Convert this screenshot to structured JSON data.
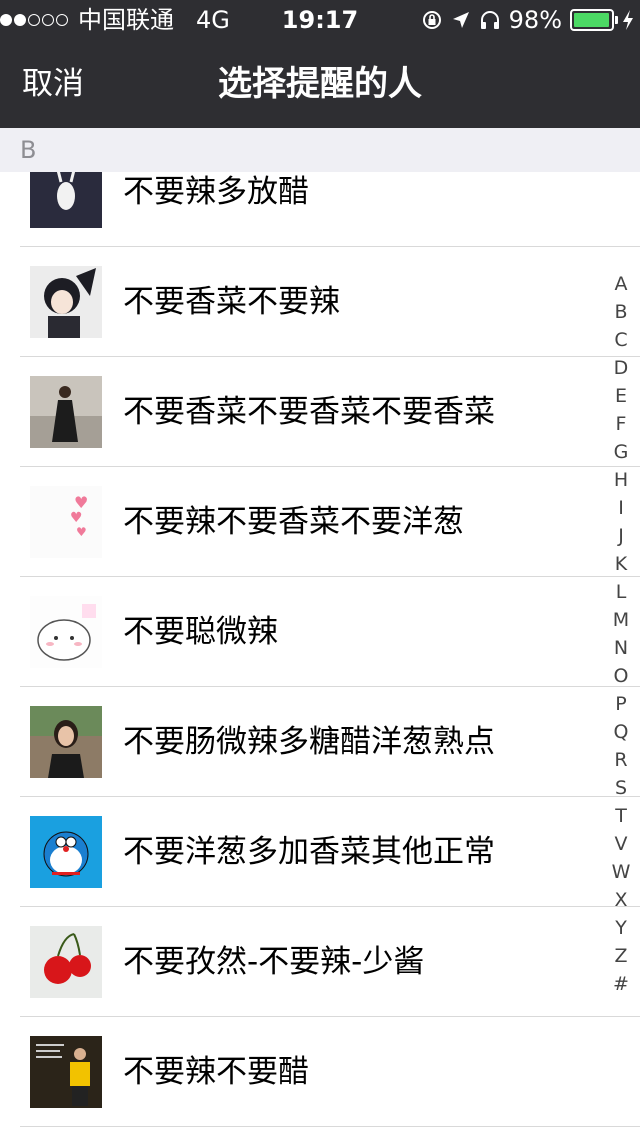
{
  "status": {
    "carrier": "中国联通",
    "network": "4G",
    "time": "19:17",
    "battery": "98%",
    "battery_level": 0.98,
    "signal_bars_filled": 2,
    "signal_bars_total": 5
  },
  "nav": {
    "cancel_label": "取消",
    "title": "选择提醒的人"
  },
  "section": "B",
  "contacts": [
    {
      "name": "不要辣多放醋",
      "avatar_icon": "rabbit-sketch-avatar",
      "avatar_bg": "#2a2b3d"
    },
    {
      "name": "不要香菜不要辣",
      "avatar_icon": "anime-girl-avatar",
      "avatar_bg": "#e8e8e8"
    },
    {
      "name": "不要香菜不要香菜不要香菜",
      "avatar_icon": "woman-dress-photo-avatar",
      "avatar_bg": "#b9b4ad"
    },
    {
      "name": "不要辣不要香菜不要洋葱",
      "avatar_icon": "pink-hearts-avatar",
      "avatar_bg": "#fbfbfb"
    },
    {
      "name": "不要聪微辣",
      "avatar_icon": "cartoon-bunny-avatar",
      "avatar_bg": "#fdfdfd"
    },
    {
      "name": "不要肠微辣多糖醋洋葱熟点",
      "avatar_icon": "woman-photo-avatar",
      "avatar_bg": "#7a6a5a"
    },
    {
      "name": "不要洋葱多加香菜其他正常",
      "avatar_icon": "doraemon-avatar",
      "avatar_bg": "#1aa0e0"
    },
    {
      "name": "不要孜然-不要辣-少酱",
      "avatar_icon": "red-cherries-avatar",
      "avatar_bg": "#e9ebe9"
    },
    {
      "name": "不要辣不要醋",
      "avatar_icon": "soccer-player-poster-avatar",
      "avatar_bg": "#2b2419"
    }
  ],
  "index_letters": [
    "A",
    "B",
    "C",
    "D",
    "E",
    "F",
    "G",
    "H",
    "I",
    "J",
    "K",
    "L",
    "M",
    "N",
    "O",
    "P",
    "Q",
    "R",
    "S",
    "T",
    "V",
    "W",
    "X",
    "Y",
    "Z",
    "#"
  ]
}
